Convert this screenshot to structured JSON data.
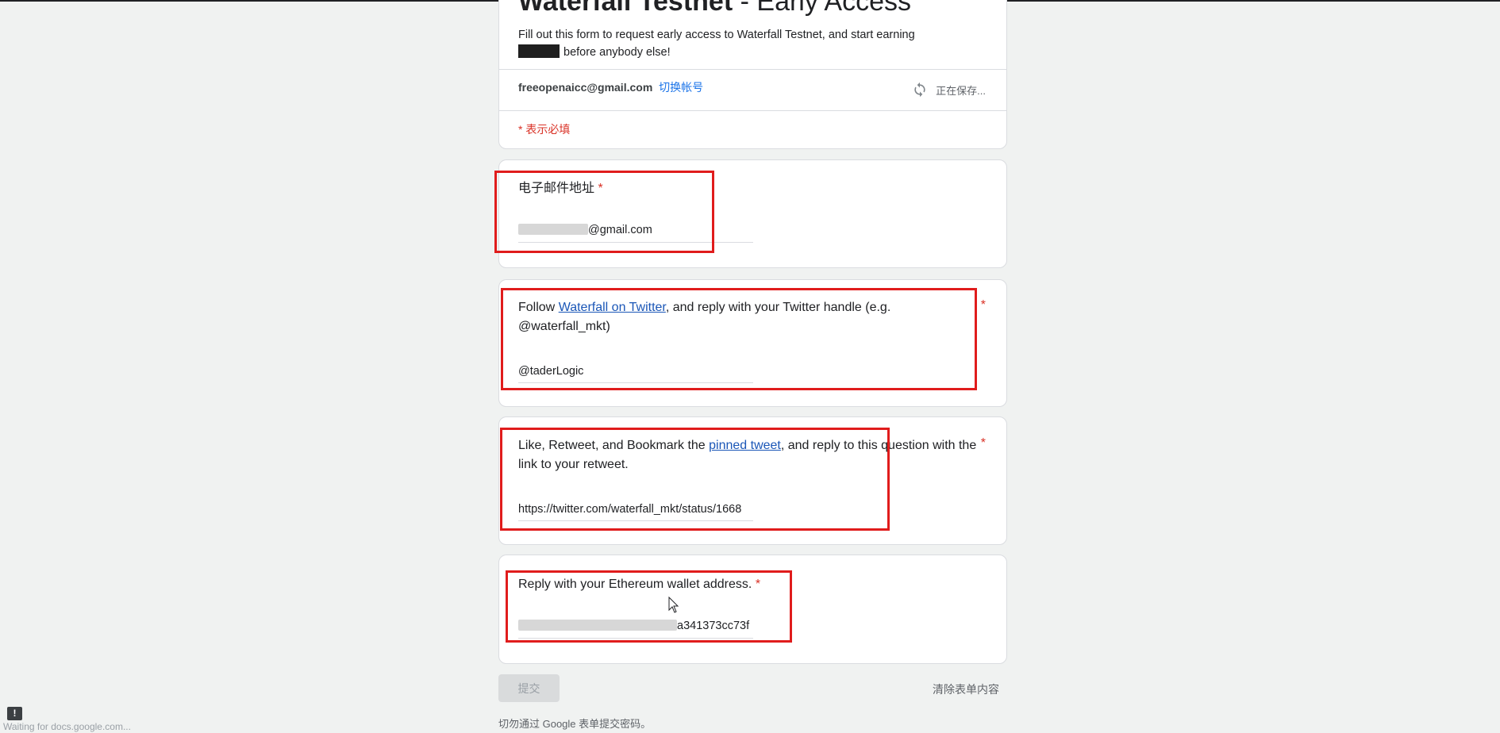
{
  "form": {
    "title_bold": "Waterfall Testnet",
    "title_rest": " - Early Access",
    "description_line1": "Fill out this form to request early access to Waterfall Testnet, and start earning",
    "description_line2": "before anybody else!",
    "account_email": "freeopenaicc@gmail.com",
    "switch_account": "切换帐号",
    "saving_status": "正在保存...",
    "required_note": "* 表示必填"
  },
  "questions": [
    {
      "label": "电子邮件地址",
      "required_mark": "*",
      "value_suffix": "@gmail.com"
    },
    {
      "label_prefix": "Follow ",
      "link_text": "Waterfall on Twitter",
      "label_suffix": ", and reply with your Twitter handle (e.g.",
      "label_line2": "@waterfall_mkt)",
      "required_mark": "*",
      "value": "@taderLogic"
    },
    {
      "label_prefix": "Like, Retweet, and Bookmark the ",
      "link_text": "pinned tweet",
      "label_suffix": ", and reply to this question with the",
      "label_line2": "link to your retweet.",
      "required_mark": "*",
      "value": "https://twitter.com/waterfall_mkt/status/1668"
    },
    {
      "label": "Reply with your Ethereum wallet address.",
      "required_mark": "*",
      "value_suffix": "a341373cc73f"
    }
  ],
  "actions": {
    "submit": "提交",
    "clear": "清除表单内容"
  },
  "footer_note": "切勿通过 Google 表单提交密码。",
  "status_bar": "Waiting for docs.google.com...",
  "icons": {
    "sync": "sync-icon",
    "feedback": "feedback-icon",
    "cursor": "mouse-cursor-icon"
  },
  "colors": {
    "required": "#d93025",
    "link": "#1a56b7",
    "annotation_box": "#e01c1c"
  }
}
